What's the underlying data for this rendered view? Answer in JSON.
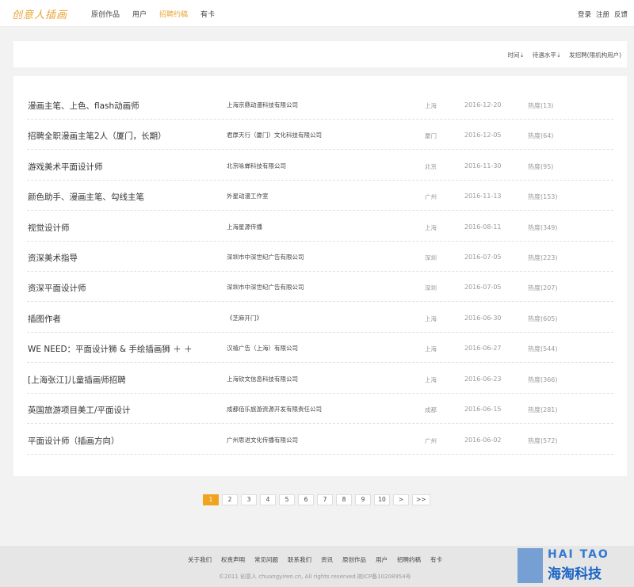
{
  "logo": "创意人插画",
  "nav": [
    "原创作品",
    "用户",
    "招聘约稿",
    "有卡"
  ],
  "user_nav": [
    "登录",
    "注册",
    "反馈"
  ],
  "filters": [
    "时间⇣",
    "待遇水平⇣",
    "发招聘(限机构用户)"
  ],
  "jobs": [
    {
      "title": "漫画主笔、上色、flash动画师",
      "company": "上海京鼎动漫科技有限公司",
      "city": "上海",
      "date": "2016-12-20",
      "heat": "热度(13)"
    },
    {
      "title": "招聘全职漫画主笔2人（厦门，长期）",
      "company": "君厚天行（厦门）文化科技有限公司",
      "city": "厦门",
      "date": "2016-12-05",
      "heat": "热度(64)"
    },
    {
      "title": "游戏美术平面设计师",
      "company": "北京咏蝉科技有限公司",
      "city": "北京",
      "date": "2016-11-30",
      "heat": "热度(95)"
    },
    {
      "title": "颜色助手、漫画主笔、勾线主笔",
      "company": "外星动漫工作室",
      "city": "广州",
      "date": "2016-11-13",
      "heat": "热度(153)"
    },
    {
      "title": "视觉设计师",
      "company": "上海星源传播",
      "city": "上海",
      "date": "2016-08-11",
      "heat": "热度(349)"
    },
    {
      "title": "资深美术指导",
      "company": "深圳市中深世纪广告有限公司",
      "city": "深圳",
      "date": "2016-07-05",
      "heat": "热度(223)"
    },
    {
      "title": "资深平面设计师",
      "company": "深圳市中深世纪广告有限公司",
      "city": "深圳",
      "date": "2016-07-05",
      "heat": "热度(207)"
    },
    {
      "title": "插图作者",
      "company": "《芝麻开门》",
      "city": "上海",
      "date": "2016-06-30",
      "heat": "热度(605)"
    },
    {
      "title": "WE NEED：平面设计狮 & 手绘插画狮 ＋ ＋",
      "company": "汉禧广告（上海）有限公司",
      "city": "上海",
      "date": "2016-06-27",
      "heat": "热度(544)"
    },
    {
      "title": "[上海张江]儿童插画师招聘",
      "company": "上海钦文信息科技有限公司",
      "city": "上海",
      "date": "2016-06-23",
      "heat": "热度(366)"
    },
    {
      "title": "英国旅游项目美工/平面设计",
      "company": "成都佰乐旅游资源开发有限责任公司",
      "city": "成都",
      "date": "2016-06-15",
      "heat": "热度(281)"
    },
    {
      "title": "平面设计师（插画方向）",
      "company": "广州思进文化传播有限公司",
      "city": "广州",
      "date": "2016-06-02",
      "heat": "热度(572)"
    }
  ],
  "pagination": [
    "1",
    "2",
    "3",
    "4",
    "5",
    "6",
    "7",
    "8",
    "9",
    "10",
    ">",
    ">>"
  ],
  "footer_nav": [
    "关于我们",
    "权责声明",
    "常见问题",
    "联系我们",
    "资讯",
    "原创作品",
    "用户",
    "招聘约稿",
    "有卡"
  ],
  "copyright": "©2011 创意人 chuangyiren.cn, All rights reserved.皖ICP备10208954号",
  "watermark": {
    "en": "HAI TAO",
    "cn": "海淘科技"
  }
}
